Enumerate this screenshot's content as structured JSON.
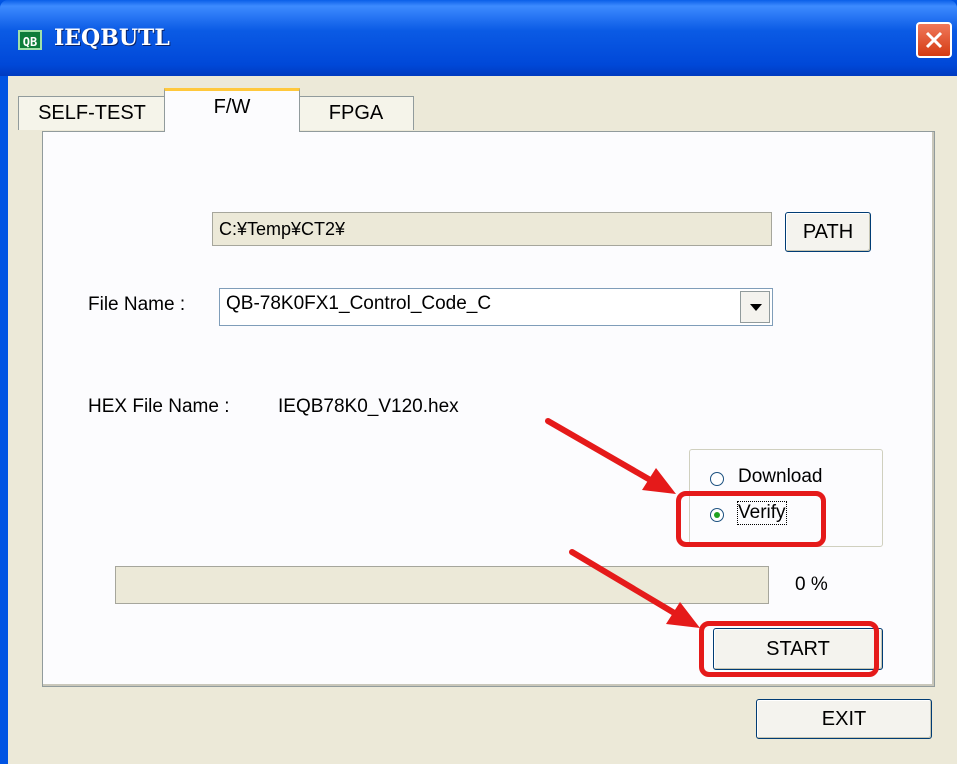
{
  "window": {
    "title": "IEQBUTL",
    "icon_text": "QB"
  },
  "tabs": [
    {
      "label": "SELF-TEST"
    },
    {
      "label": "F/W"
    },
    {
      "label": "FPGA"
    }
  ],
  "firmware": {
    "path_value": "C:¥Temp¥CT2¥",
    "path_button": "PATH",
    "file_name_label": "File Name :",
    "file_name_value": "QB-78K0FX1_Control_Code_C",
    "hex_label": "HEX File Name :",
    "hex_value": "IEQB78K0_V120.hex",
    "options": {
      "download": "Download",
      "verify": "Verify",
      "selected": "verify"
    },
    "progress_text": "0 %",
    "progress_percent": 0,
    "start_button": "START"
  },
  "footer": {
    "exit_button": "EXIT"
  },
  "annotations": {
    "highlight_color": "#e51a1a"
  }
}
